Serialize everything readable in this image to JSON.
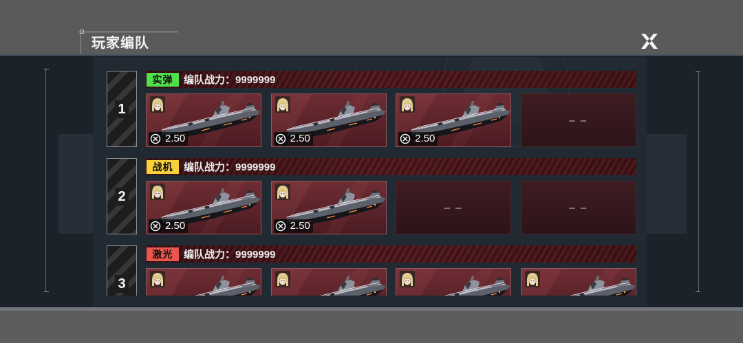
{
  "header": {
    "title": "玩家编队",
    "close_icon": "close-icon"
  },
  "colors": {
    "panel": "#1b222a",
    "card_fill": "#5e252b",
    "empty_card": "#361a1f"
  },
  "formations": [
    {
      "index": "1",
      "tag": "实弹",
      "tag_color": "#4fe04c",
      "power_label": "编队战力：",
      "power_value": "9999999",
      "slots": [
        {
          "filled": true,
          "avatar": "pilot-avatar",
          "ship": "battleship-image",
          "cost_icon": "cross-circle-icon",
          "cost": "2.50"
        },
        {
          "filled": true,
          "avatar": "pilot-avatar",
          "ship": "battleship-image",
          "cost_icon": "cross-circle-icon",
          "cost": "2.50"
        },
        {
          "filled": true,
          "avatar": "pilot-avatar",
          "ship": "battleship-image",
          "cost_icon": "cross-circle-icon",
          "cost": "2.50"
        },
        {
          "filled": false,
          "empty_label": "– –"
        }
      ]
    },
    {
      "index": "2",
      "tag": "战机",
      "tag_color": "#f7d03a",
      "power_label": "编队战力：",
      "power_value": "9999999",
      "slots": [
        {
          "filled": true,
          "avatar": "pilot-avatar",
          "ship": "battleship-image",
          "cost_icon": "cross-circle-icon",
          "cost": "2.50"
        },
        {
          "filled": true,
          "avatar": "pilot-avatar",
          "ship": "battleship-image",
          "cost_icon": "cross-circle-icon",
          "cost": "2.50"
        },
        {
          "filled": false,
          "empty_label": "– –"
        },
        {
          "filled": false,
          "empty_label": "– –"
        }
      ]
    },
    {
      "index": "3",
      "tag": "激光",
      "tag_color": "#e8574d",
      "power_label": "编队战力：",
      "power_value": "9999999",
      "slots": [
        {
          "filled": true,
          "avatar": "pilot-avatar",
          "ship": "battleship-image"
        },
        {
          "filled": true,
          "avatar": "pilot-avatar",
          "ship": "battleship-image"
        },
        {
          "filled": true,
          "avatar": "pilot-avatar",
          "ship": "battleship-image"
        },
        {
          "filled": true,
          "avatar": "pilot-avatar",
          "ship": "battleship-image"
        }
      ]
    }
  ]
}
